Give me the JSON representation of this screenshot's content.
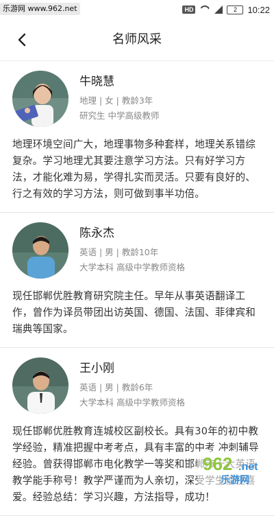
{
  "status_bar": {
    "watermark": "乐游网 www.962.net",
    "badge": "HD",
    "battery": "2",
    "time": "10:22"
  },
  "header": {
    "title": "名师风采"
  },
  "teachers": [
    {
      "name": "牛晓慧",
      "meta": "地理 | 女 | 教龄3年",
      "qualification": "研究生 中学高级教师",
      "bio": "地理环境空间广大，地理事物多种套样，地理关系错综复杂。学习地理尤其要注意学习方法。只有好学习方法，才能化难为易，学得扎实而灵活。只要有良好的、行之有效的学习方法，则可做到事半功倍。"
    },
    {
      "name": "陈永杰",
      "meta": "英语 | 男 | 教龄10年",
      "qualification": "大学本科 高级中学教师资格",
      "bio": "现任邯郸优胜教育研究院主任。早年从事英语翻译工作，曾作为译员带团出访英国、德国、法国、菲律宾和瑞典等国家。"
    },
    {
      "name": "王小刚",
      "meta": "英语 | 男 | 教龄6年",
      "qualification": "大学本科 高级中学教师资格",
      "bio": "现任邯郸优胜教育连城校区副校长。具有30年的初中教学经验，精准把握中考考点，具有丰富的中考 冲刺辅导经验。曾获得邯郸市电化教学一等奖和邯郸市十大英语教学能手称号！教学严谨而为人亲切，深受学生信任喜爱。经验总结：学习兴趣，方法指导，成功！"
    }
  ],
  "watermark_logo": {
    "text_top": "962",
    "text_domain": ".net",
    "text_bottom": "乐游网"
  }
}
